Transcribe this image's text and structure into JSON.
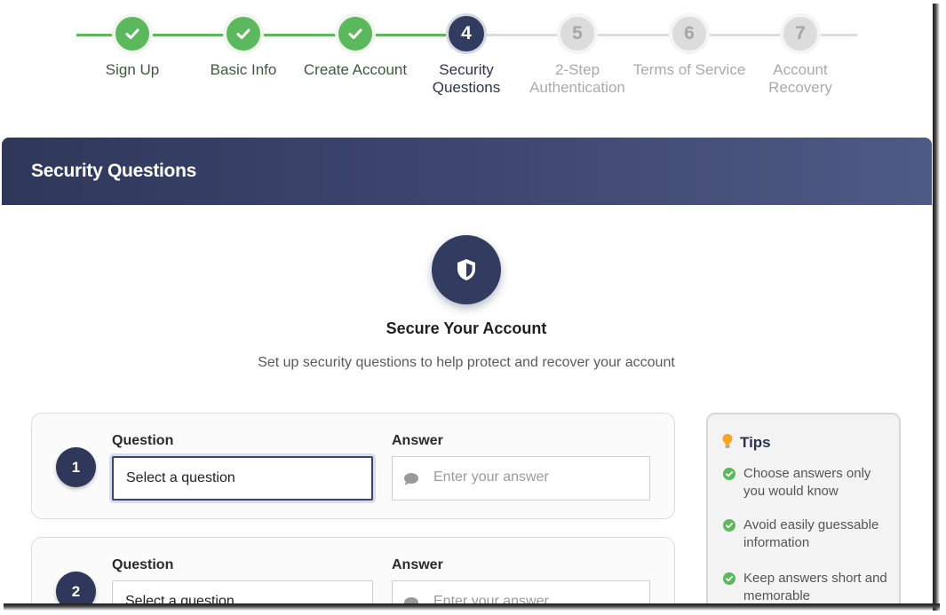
{
  "stepper": {
    "steps": [
      {
        "number": "1",
        "label": [
          "Sign Up"
        ],
        "status": "complete"
      },
      {
        "number": "2",
        "label": [
          "Basic Info"
        ],
        "status": "complete"
      },
      {
        "number": "3",
        "label": [
          "Create Account"
        ],
        "status": "complete"
      },
      {
        "number": "4",
        "label": [
          "Security",
          "Questions"
        ],
        "status": "current"
      },
      {
        "number": "5",
        "label": [
          "2-Step",
          "Authentication"
        ],
        "status": "upcoming"
      },
      {
        "number": "6",
        "label": [
          "Terms of Service"
        ],
        "status": "upcoming"
      },
      {
        "number": "7",
        "label": [
          "Account",
          "Recovery"
        ],
        "status": "upcoming"
      }
    ],
    "colors": {
      "complete": "#5cb85c",
      "current": "#323c60",
      "upcoming": "#dcdcdc"
    }
  },
  "header": {
    "title": "Security Questions"
  },
  "intro": {
    "icon": "shield-icon",
    "title": "Secure Your Account",
    "subtitle": "Set up security questions to help protect and recover your account"
  },
  "questions": [
    {
      "number": "1",
      "question_label": "Question",
      "question_value": "Select a question",
      "answer_label": "Answer",
      "answer_placeholder": "Enter your answer"
    },
    {
      "number": "2",
      "question_label": "Question",
      "question_value": "Select a question",
      "answer_label": "Answer",
      "answer_placeholder": "Enter your answer"
    }
  ],
  "tips": {
    "title": "Tips",
    "items": [
      [
        "Choose answers only",
        "you would know"
      ],
      [
        "Avoid easily guessable",
        "information"
      ],
      [
        "Keep answers short and",
        "memorable"
      ]
    ]
  }
}
